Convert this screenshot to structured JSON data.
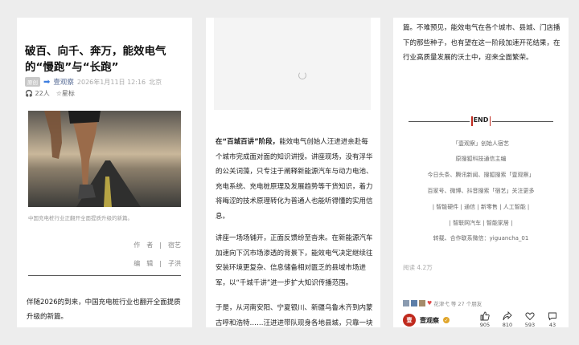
{
  "panel1": {
    "title": "破百、向千、奔万，能效电气的“慢跑”与“长跑”",
    "tag": "原创",
    "author": "壹观察",
    "datetime": "2026年1月11日 12:16",
    "location": "北京",
    "listen": "22人",
    "star": "星标",
    "caption": "中国充电桩行业正翻开全面提质升级的新篇。",
    "credit_author": "作　者　|　宿艺",
    "credit_editor": "编　辑　|　子洪",
    "body": "伴随2026的到来，中国充电桩行业也翻开全面提质升级的新篇。"
  },
  "panel2": {
    "p1_lead": "在“百城百讲”阶段，",
    "p1_rest": "能效电气创始人汪进进亲赴每个城市完成面对面的知识讲授。讲座现场，没有浮华的公关词藻，只专注于阐释新能源汽车与动力电池、充电系统、充电桩原理及发展趋势等干货知识，着力将晦涩的技术原理转化为普通人也能听得懂的实用信息。",
    "p2": "讲座一场场铺开，正面反馈纷至沓来。在新能源汽车加速向下沉市场渗透的背景下，能效电气决定继续往安装环境更复杂、信息储备相对匮乏的县域市场进军，以“千城千讲”进一步扩大知识传播范围。",
    "p3": "于是，从河南安阳、宁夏银川、新疆乌鲁木齐到内蒙古呼和浩特……汪进进带队现身各地县城，只靠一块白板、几台样桩，深入浅出的讲解，便一点点把新能"
  },
  "panel3": {
    "body": "篇。不难预见，能效电气在各个城市、县城、门店播下的那些种子，也有望在这一阶段加速开花结果，在行业高质量发展的沃土中，迎来全面繁荣。",
    "end": "END",
    "info": [
      "「壹观察」创始人宿艺",
      "原搜狐科技通信主编",
      "今日头条、腾讯新闻、搜狐搜索「壹观察」",
      "百家号、微博、抖音搜索「宿艺」关注更多",
      "| 智能硬件 | 通信 | 新零售 | 人工智能 |",
      "| 智联网汽车 | 智能家居 |",
      "转载、合作联系微信：yiguancha_01"
    ],
    "read": "阅读 4.2万",
    "likes": "花津弋 等 27 个朋友",
    "account_name": "壹观察",
    "logo_char": "壹",
    "actions": [
      {
        "icon": "thumbs-up-icon",
        "count": "905"
      },
      {
        "icon": "share-icon",
        "count": "810"
      },
      {
        "icon": "heart-icon",
        "count": "593"
      },
      {
        "icon": "comment-icon",
        "count": "43"
      }
    ]
  }
}
